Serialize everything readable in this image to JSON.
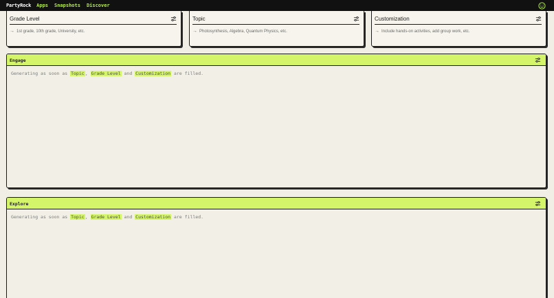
{
  "topbar": {
    "brand": "PartyRock",
    "nav": [
      "Apps",
      "Snapshots",
      "Discover"
    ]
  },
  "inputs": [
    {
      "title": "Grade Level",
      "placeholder": "1st grade, 10th grade, University, etc."
    },
    {
      "title": "Topic",
      "placeholder": "Photosynthesis, Algebra, Quantum Physics, etc."
    },
    {
      "title": "Customization",
      "placeholder": "Include hands-on activities, add group work, etc."
    }
  ],
  "widgets": [
    {
      "title": "Engage",
      "status": {
        "prefix": "Generating as soon as",
        "ref1": "Topic",
        "sep": ",",
        "ref2": "Grade Level",
        "and": "and",
        "ref3": "Customization",
        "suffix": "are filled."
      }
    },
    {
      "title": "Explore",
      "status": {
        "prefix": "Generating as soon as",
        "ref1": "Topic",
        "sep": ",",
        "ref2": "Grade Level",
        "and": "and",
        "ref3": "Customization",
        "suffix": "are filled."
      }
    }
  ],
  "colors": {
    "accent": "#d4f56a",
    "nav": "#b5e853",
    "topbar": "#111111",
    "background": "#f1efe5"
  },
  "icons": {
    "filter": "sliders-icon",
    "profile": "smiley-icon",
    "placeholder_arrow": "arrow-right-icon"
  }
}
